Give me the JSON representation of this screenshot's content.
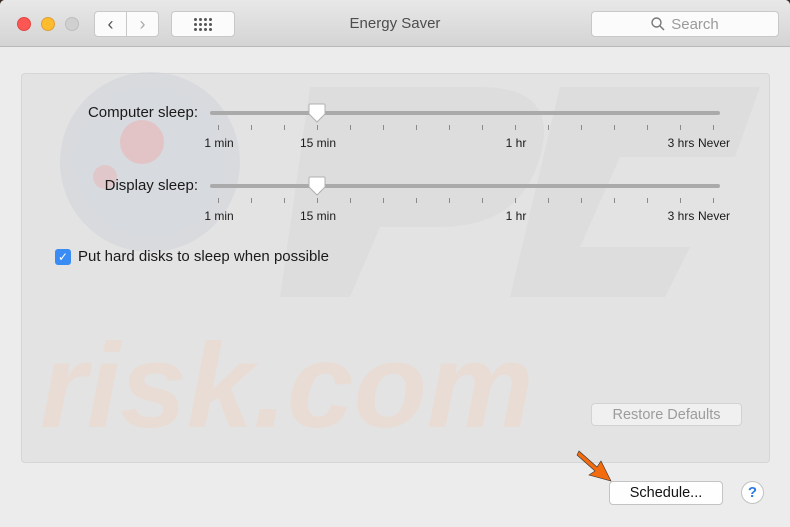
{
  "window": {
    "title": "Energy Saver",
    "search_placeholder": "Search"
  },
  "toolbar": {
    "back_icon": "chevron-left",
    "forward_icon": "chevron-right",
    "grid_icon": "show-all-grid"
  },
  "sliders": [
    {
      "label": "Computer sleep:",
      "value": "15 min",
      "tick_count": 16,
      "thumb_tick_index": 3,
      "tick_labels": [
        {
          "text": "1 min",
          "tick_index": 0
        },
        {
          "text": "15 min",
          "tick_index": 3
        },
        {
          "text": "1 hr",
          "tick_index": 9
        },
        {
          "text": "3 hrs",
          "tick_index": 14
        },
        {
          "text": "Never",
          "tick_index": 15
        }
      ]
    },
    {
      "label": "Display sleep:",
      "value": "15 min",
      "tick_count": 16,
      "thumb_tick_index": 3,
      "tick_labels": [
        {
          "text": "1 min",
          "tick_index": 0
        },
        {
          "text": "15 min",
          "tick_index": 3
        },
        {
          "text": "1 hr",
          "tick_index": 9
        },
        {
          "text": "3 hrs",
          "tick_index": 14
        },
        {
          "text": "Never",
          "tick_index": 15
        }
      ]
    }
  ],
  "options": {
    "hard_disk_sleep": {
      "label": "Put hard disks to sleep when possible",
      "checked": true
    }
  },
  "buttons": {
    "restore_defaults": "Restore Defaults",
    "restore_defaults_enabled": false,
    "schedule": "Schedule...",
    "help": "?"
  },
  "watermark": {
    "text": "risk.com",
    "logo": "PC"
  },
  "colors": {
    "accent": "#3a8cf5",
    "arrow": "#f26b0f",
    "help": "#2a7ae2"
  }
}
